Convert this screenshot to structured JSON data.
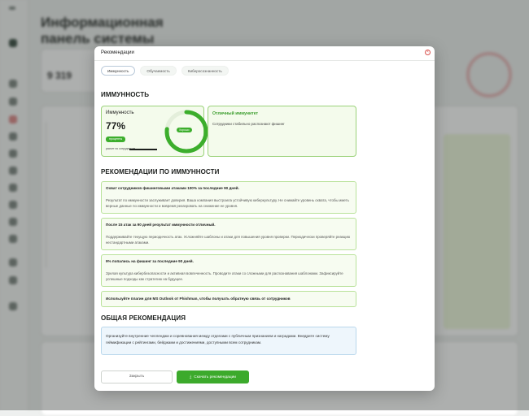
{
  "background": {
    "title_line1": "Информационная",
    "title_line2": "панель системы",
    "stat_value": "9 319"
  },
  "modal": {
    "title": "Рекомендации",
    "close_icon": "×",
    "tabs": [
      {
        "label": "Иммунность",
        "active": true
      },
      {
        "label": "Обучаемость",
        "active": false
      },
      {
        "label": "Киберосознанность",
        "active": false
      }
    ],
    "immunity_section": {
      "heading": "ИММУННОСТЬ",
      "label": "Иммунность",
      "value": "77%",
      "value_fraction": 0.77,
      "unit_pill": "проценты",
      "note": "расчет по сотрудникам",
      "ring_pill": "Хорошо",
      "ring_color": "#3cae2c",
      "excellent_title": "Отличный иммунитет",
      "excellent_desc": "Сотрудники стабильно распознают фишинг"
    },
    "recommendations_heading": "РЕКОМЕНДАЦИИ ПО ИММУННОСТИ",
    "recommendations": [
      {
        "title": "Охват сотрудников фишинговыми атаками 100% за последние 90 дней.",
        "body": "Результат по иммунности заслуживает доверия. Ваша компания выстроила устойчивую киберкультуру. Не снижайте уровень охвата, чтобы иметь верные данные по иммунности и вовремя реагировать на снижение ее уровня."
      },
      {
        "title": "После 15 атак за 90 дней результат иммунности отличный.",
        "body": "Поддерживайте текущую периодичность атак. Усложняйте шаблоны и атаки для повышения уровня проверки. Периодически проверяйте реакцию нестандартными атаками."
      },
      {
        "title": "9% попались на фишинг за последние 90 дней.",
        "body": "Зрелая культура кибербезопасности и активная вовлеченность. Проводите атаки со сложными для распознавания шаблонами. Зафиксируйте успешные подходы как стратегию на будущее."
      },
      {
        "title": "Используйте плагин для MS Outlook от Phishman, чтобы получать обратную связь от сотрудников",
        "body": ""
      }
    ],
    "general_heading": "ОБЩАЯ РЕКОМЕНДАЦИЯ",
    "general_text": "Организуйте внутренние челленджи и соревнования между отделами с публичным признанием и наградами. Внедрите систему геймификации с рейтингами, бейджами и достижениями, доступными всем сотрудникам.",
    "close_button": "Закрыть",
    "download_button": "Скачать рекомендации",
    "download_icon": "⤓"
  }
}
